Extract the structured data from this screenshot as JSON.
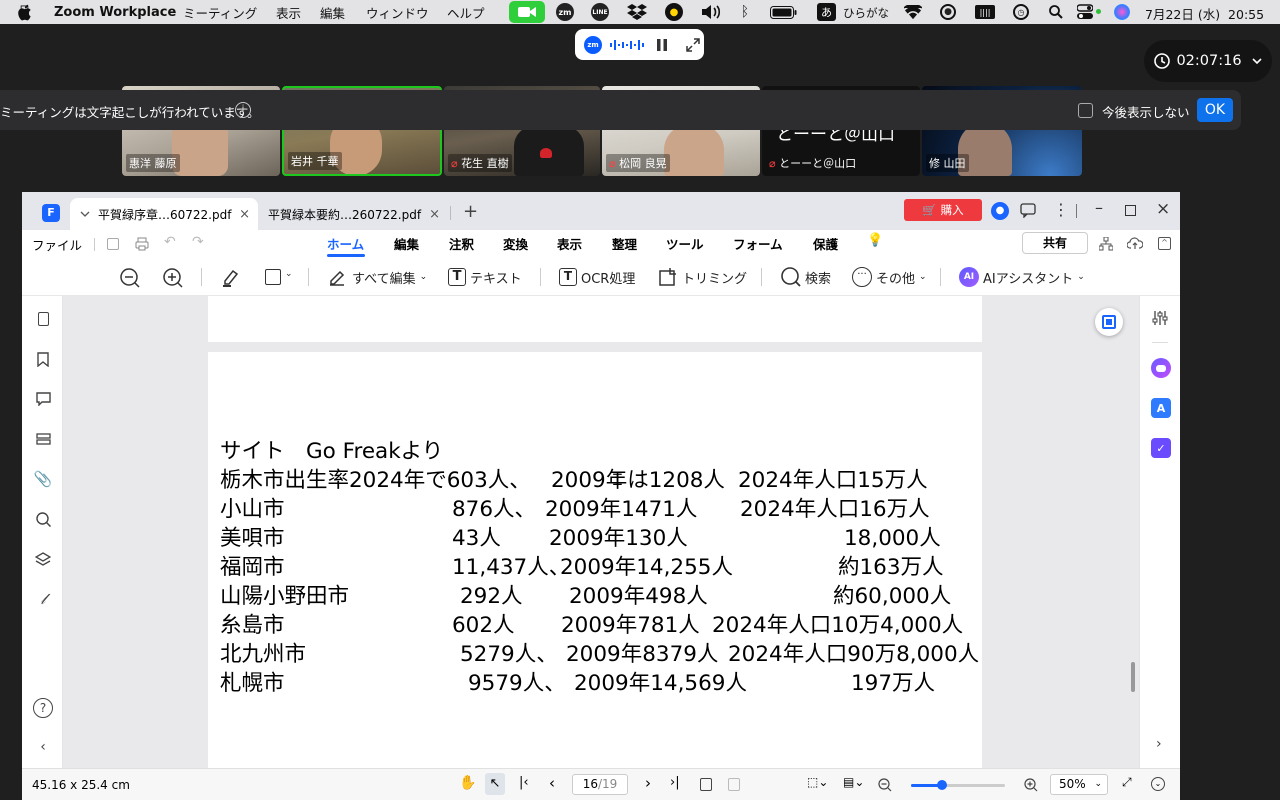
{
  "menubar": {
    "app_name": "Zoom Workplace",
    "menus": [
      "ミーティング",
      "表示",
      "編集",
      "ウィンドウ",
      "ヘルプ"
    ],
    "input_method": "ひらがな",
    "input_method_badge": "あ",
    "datetime": "7月22日 (水)  20:55"
  },
  "zoom": {
    "timer": "02:07:16",
    "transcript_notice": "ミーティングは文字起こしが行われています。",
    "dont_show_label": "今後表示しない",
    "ok_label": "OK",
    "participants": [
      {
        "name": "惠洋 藤原",
        "muted": false
      },
      {
        "name": "岩井 千華",
        "muted": false
      },
      {
        "name": "花生 直樹",
        "muted": true
      },
      {
        "name": "松岡 良晃",
        "muted": true
      },
      {
        "name": "とーーと＠山口",
        "muted": true
      },
      {
        "name": "修 山田",
        "muted": false
      }
    ],
    "tile_big_text": "とーーと＠山口"
  },
  "pdf": {
    "tabs": [
      {
        "title": "平賀緑序章…60722.pdf",
        "active": true
      },
      {
        "title": "平賀緑本要約…260722.pdf",
        "active": false
      }
    ],
    "buy_label": "購入",
    "file_menu": "ファイル",
    "ribbon_tabs": [
      "ホーム",
      "編集",
      "注釈",
      "変換",
      "表示",
      "整理",
      "ツール",
      "フォーム",
      "保護"
    ],
    "share_label": "共有",
    "tools": {
      "edit_all": "すべて編集",
      "text": "テキスト",
      "ocr": "OCR処理",
      "trim": "トリミング",
      "search": "検索",
      "more": "その他",
      "ai": "AIアシスタント"
    },
    "content": {
      "title": "サイト　Go Freakより",
      "rows": [
        {
          "city": "栃木市出生率2024年で603人、",
          "y2009": "2009年は1208人",
          "pop": "2024年人口15万人"
        },
        {
          "city": "小山市",
          "births": "876人、",
          "y2009": "2009年1471人",
          "pop": "2024年人口16万人"
        },
        {
          "city": "美唄市",
          "births": "43人",
          "y2009": "2009年130人",
          "pop": "18,000人"
        },
        {
          "city": "福岡市",
          "births": "11,437人、",
          "y2009": "2009年14,255人",
          "pop": "約163万人"
        },
        {
          "city": "山陽小野田市",
          "births": "292人",
          "y2009": "2009年498人",
          "pop": "約60,000人"
        },
        {
          "city": "糸島市",
          "births": "602人",
          "y2009": "2009年781人",
          "pop": "2024年人口10万4,000人"
        },
        {
          "city": "北九州市",
          "births": "5279人、",
          "y2009": "2009年8379人",
          "pop": "2024年人口90万8,000人"
        },
        {
          "city": "札幌市",
          "births": "9579人、",
          "y2009": "2009年14,569人",
          "pop": "197万人"
        }
      ]
    },
    "status": {
      "page_size": "45.16 x 25.4 cm",
      "current_page": "16",
      "total_pages": "/19",
      "zoom": "50%",
      "zoom_fraction": 0.33
    }
  }
}
